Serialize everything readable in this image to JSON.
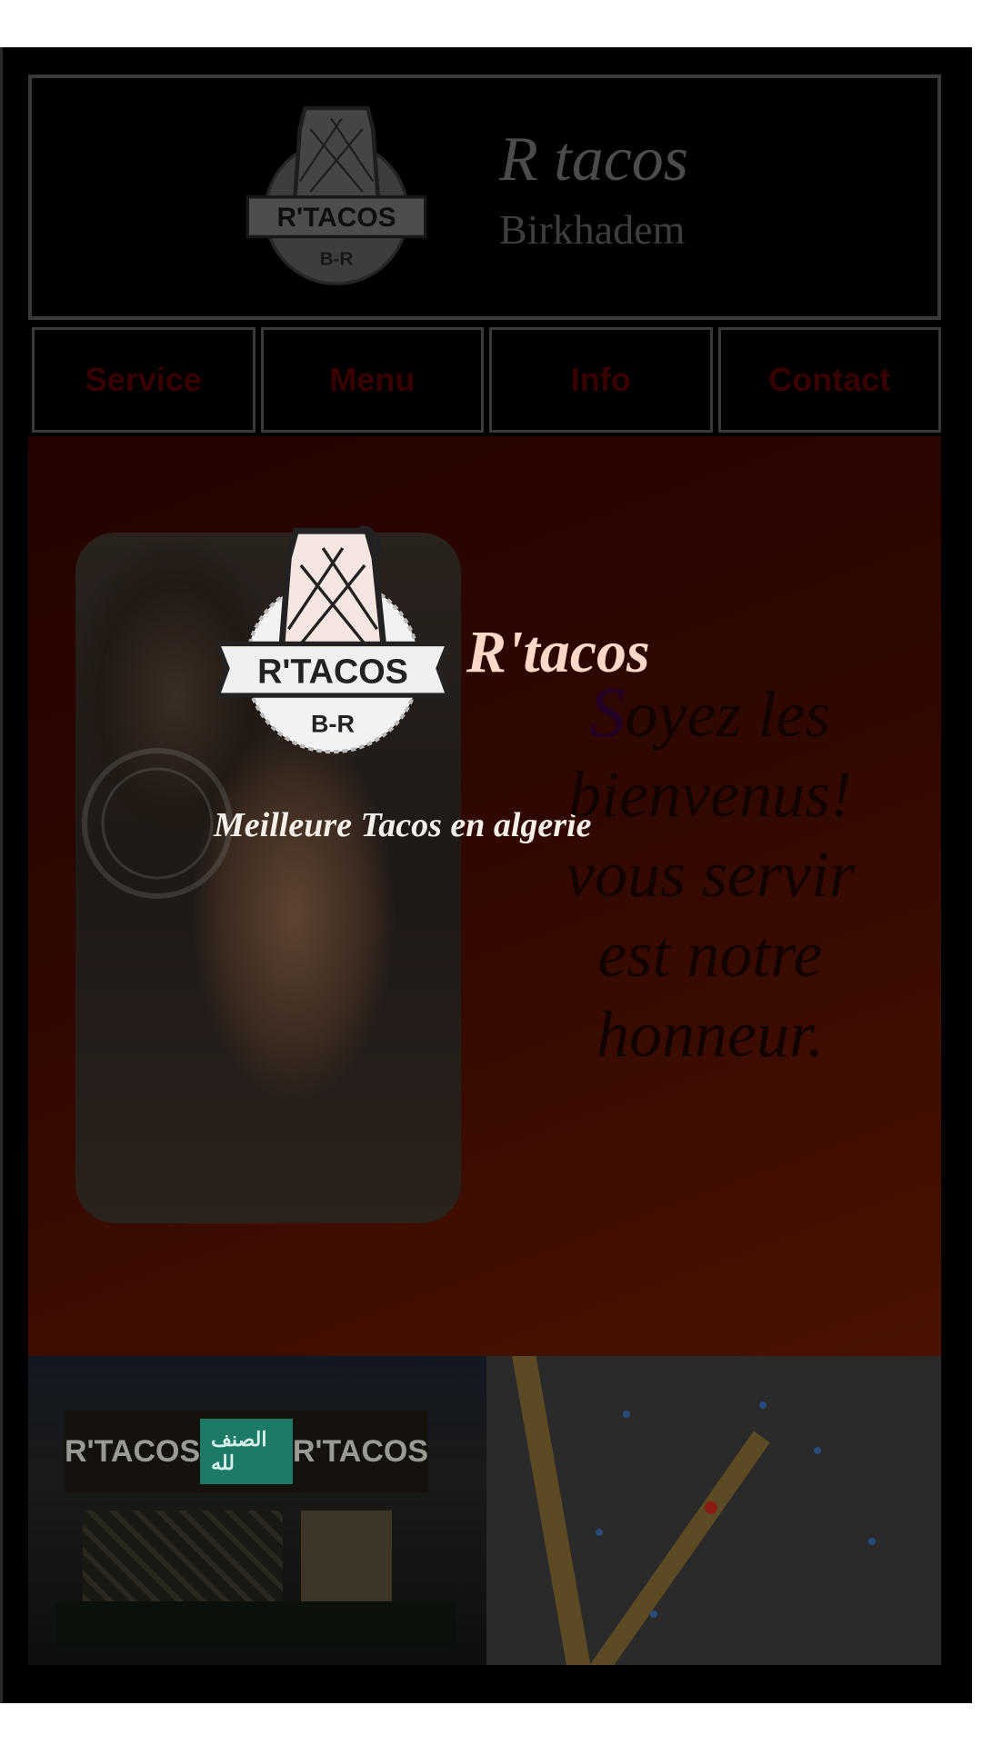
{
  "header": {
    "title": "R tacos",
    "subtitle": "Birkhadem",
    "logo_text": "R'TACOS",
    "logo_sub": "B-R"
  },
  "nav": {
    "items": [
      "Service",
      "Menu",
      "Info",
      "Contact"
    ]
  },
  "hero": {
    "logo_text": "R'TACOS",
    "logo_sub": "B-R",
    "name": "R'tacos",
    "tagline": "Meilleure Tacos en algerie",
    "welcome_first": "S",
    "welcome_rest": "oyez les bienvenus! vous servir est notre honneur."
  },
  "storefront": {
    "sign_left": "R'TACOS",
    "sign_middle": "الصنف لله",
    "sign_right": "R'TACOS"
  },
  "colors": {
    "page_bg": "#000000",
    "nav_text": "#3a0000",
    "hero_gradient_start": "#250200",
    "hero_gradient_end": "#4a1200",
    "hero_name": "#ffd7c8"
  },
  "icons": [
    "rtacos-logo-icon",
    "map-pin-icon"
  ]
}
